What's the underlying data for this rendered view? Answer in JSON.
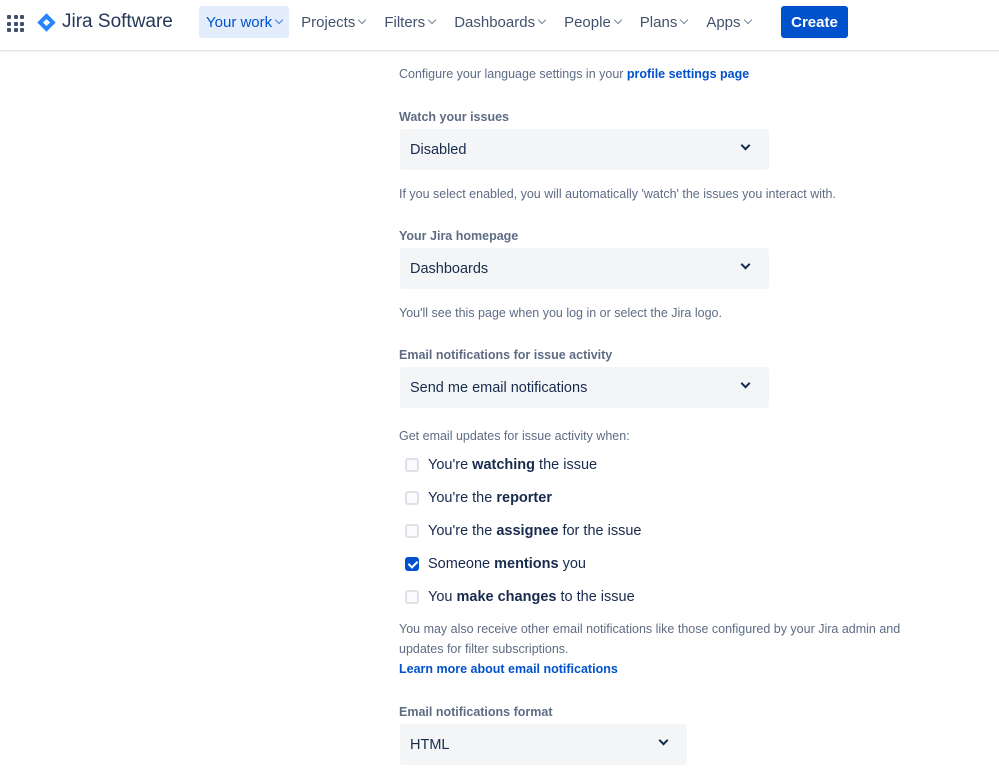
{
  "nav": {
    "product": "Jira Software",
    "items": [
      "Your work",
      "Projects",
      "Filters",
      "Dashboards",
      "People",
      "Plans",
      "Apps"
    ],
    "create": "Create"
  },
  "language": {
    "text": "Configure your language settings in your ",
    "link": "profile settings page"
  },
  "watch": {
    "label": "Watch your issues",
    "value": "Disabled",
    "help": "If you select enabled, you will automatically 'watch' the issues you interact with."
  },
  "homepage": {
    "label": "Your Jira homepage",
    "value": "Dashboards",
    "help": "You'll see this page when you log in or select the Jira logo."
  },
  "email": {
    "label": "Email notifications for issue activity",
    "value": "Send me email notifications",
    "help": "Get email updates for issue activity when:",
    "options": [
      {
        "pre": "You're ",
        "bold": "watching",
        "post": " the issue",
        "checked": false
      },
      {
        "pre": "You're the ",
        "bold": "reporter",
        "post": "",
        "checked": false
      },
      {
        "pre": "You're the ",
        "bold": "assignee",
        "post": " for the issue",
        "checked": false
      },
      {
        "pre": "Someone ",
        "bold": "mentions",
        "post": " you",
        "checked": true
      },
      {
        "pre": "You ",
        "bold": "make changes",
        "post": " to the issue",
        "checked": false
      }
    ],
    "note1": "You may also receive other email notifications like those configured by your Jira admin and",
    "note2": "updates for filter subscriptions.",
    "learn": "Learn more about email notifications"
  },
  "format": {
    "label": "Email notifications format",
    "value": "HTML"
  }
}
